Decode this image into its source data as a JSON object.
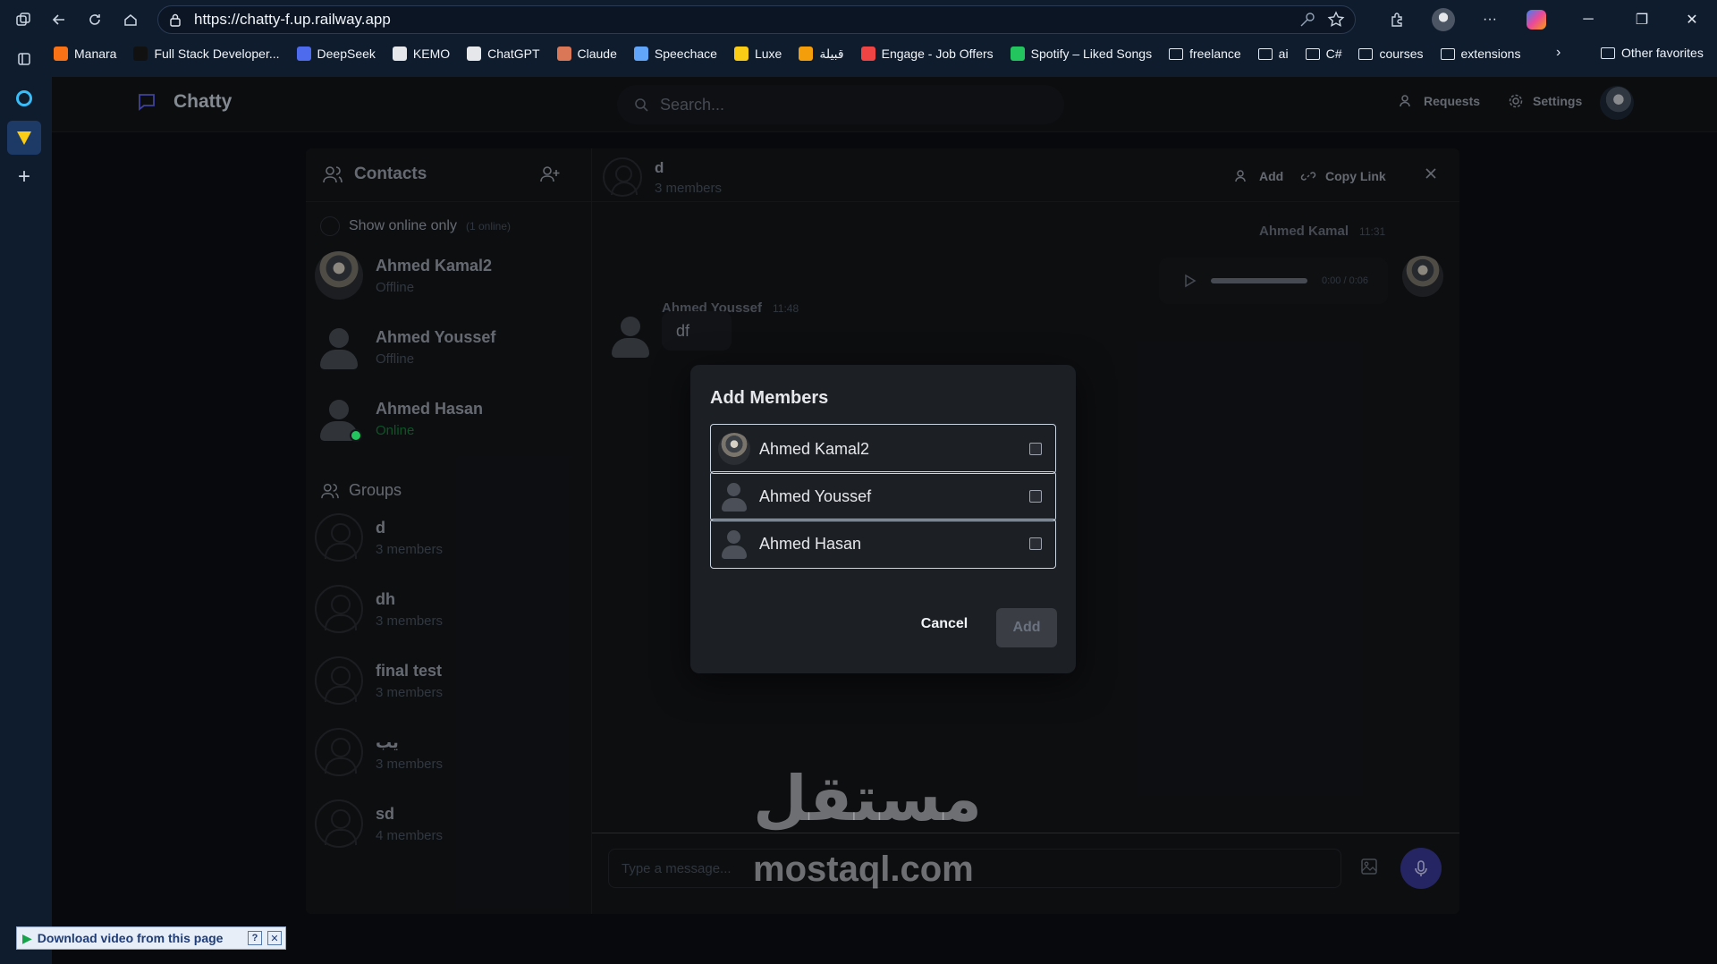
{
  "browser": {
    "url": "https://chatty-f.up.railway.app",
    "bookmarks": [
      {
        "label": "Manara",
        "color": "#f97316"
      },
      {
        "label": "Full Stack Developer...",
        "color": "#111111"
      },
      {
        "label": "DeepSeek",
        "color": "#4f6bed"
      },
      {
        "label": "KEMO",
        "color": "#e5e7eb"
      },
      {
        "label": "ChatGPT",
        "color": "#e5e7eb"
      },
      {
        "label": "Claude",
        "color": "#d97757"
      },
      {
        "label": "Speechace",
        "color": "#60a5fa"
      },
      {
        "label": "Luxe",
        "color": "#facc15"
      },
      {
        "label": "قبيلة",
        "color": "#f59e0b"
      },
      {
        "label": "Engage - Job Offers",
        "color": "#ef4444"
      },
      {
        "label": "Spotify – Liked Songs",
        "color": "#22c55e"
      }
    ],
    "bookmark_folders": [
      "freelance",
      "ai",
      "C#",
      "courses",
      "extensions"
    ],
    "other_favorites": "Other favorites"
  },
  "app": {
    "brand": "Chatty",
    "search_placeholder": "Search...",
    "requests_label": "Requests",
    "settings_label": "Settings"
  },
  "contacts": {
    "title": "Contacts",
    "online_only_label": "Show online only",
    "online_count": "(1 online)",
    "items": [
      {
        "name": "Ahmed Kamal2",
        "status": "Offline"
      },
      {
        "name": "Ahmed Youssef",
        "status": "Offline"
      },
      {
        "name": "Ahmed Hasan",
        "status": "Online"
      }
    ],
    "groups_title": "Groups",
    "groups": [
      {
        "name": "d",
        "members": "3 members"
      },
      {
        "name": "dh",
        "members": "3 members"
      },
      {
        "name": "final test",
        "members": "3 members"
      },
      {
        "name": "يب",
        "members": "3 members"
      },
      {
        "name": "sd",
        "members": "4 members"
      }
    ]
  },
  "chat": {
    "name": "d",
    "members": "3 members",
    "add_label": "Add",
    "copy_link_label": "Copy Link",
    "messages": [
      {
        "sender": "Ahmed Kamal",
        "time": "11:31",
        "audio_time": "0:00 / 0:06"
      },
      {
        "sender": "Ahmed Youssef",
        "time": "11:48",
        "text": "df"
      }
    ],
    "input_placeholder": "Type a message..."
  },
  "modal": {
    "title": "Add Members",
    "members": [
      "Ahmed Kamal2",
      "Ahmed Youssef",
      "Ahmed Hasan"
    ],
    "cancel_label": "Cancel",
    "add_label": "Add"
  },
  "overlay_text": {
    "watermark_ar": "مستقل",
    "watermark_en": "mostaql.com",
    "download_bar": "Download video from this page"
  }
}
